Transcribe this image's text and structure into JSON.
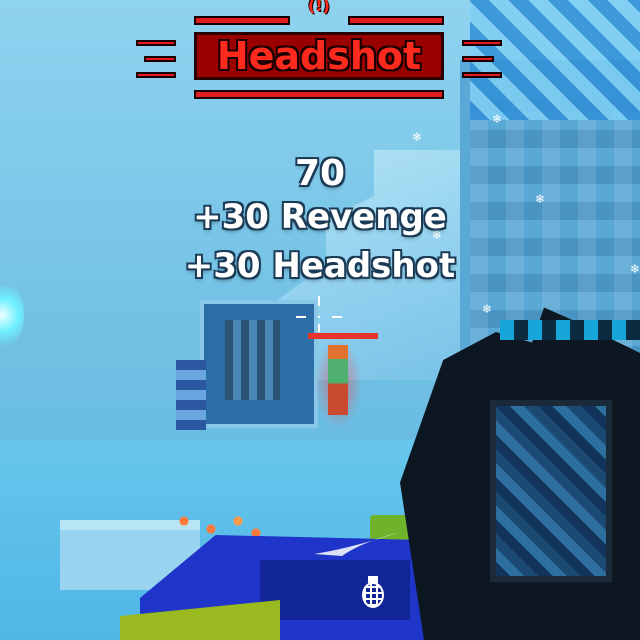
{
  "hud": {
    "headshot_banner": {
      "label": "Headshot",
      "top_mark": "(!)"
    },
    "score": {
      "main": "70",
      "bonus_lines": [
        "+30 Revenge",
        "+30 Headshot"
      ]
    },
    "crosshair": "crosshair",
    "grenade_icon": "grenade-icon"
  },
  "colors": {
    "banner_red": "#e11d1d",
    "banner_dark": "#9a0000",
    "score_text": "#ffffff",
    "enemy_highlight": "#e8342c",
    "scene_ice": "#6fc3e6"
  }
}
